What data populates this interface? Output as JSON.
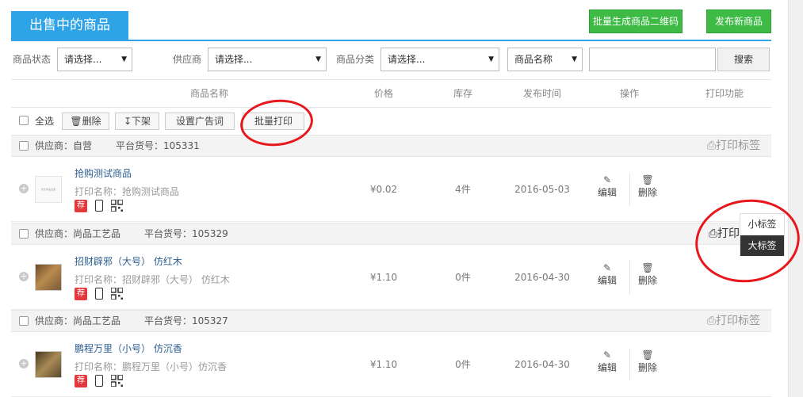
{
  "header": {
    "title": "出售中的商品",
    "qr_button": "批量生成商品二维码",
    "publish_button": "发布新商品"
  },
  "filters": {
    "status_label": "商品状态",
    "status_value": "请选择...",
    "supplier_label": "供应商",
    "supplier_value": "请选择...",
    "category_label": "商品分类",
    "category_value": "请选择...",
    "field_value": "商品名称",
    "keyword_value": "",
    "search_button": "搜索"
  },
  "table_header": {
    "name": "商品名称",
    "price": "价格",
    "stock": "库存",
    "date": "发布时间",
    "ops": "操作",
    "print": "打印功能"
  },
  "batch": {
    "select_all": "全选",
    "delete": "删除",
    "unlist": "下架",
    "ad": "设置广告词",
    "batch_print": "批量打印"
  },
  "groups": [
    {
      "supplier": "供应商：自营",
      "sku": "平台货号：105331",
      "print_label": "打印标签",
      "product": {
        "name": "抢购测试商品",
        "print_name": "打印名称：抢购测试商品",
        "thumb_text": "暂无商品主图",
        "tag": "荐",
        "price": "¥0.02",
        "stock": "4件",
        "date": "2016-05-03",
        "edit": "编辑",
        "delete": "删除"
      }
    },
    {
      "supplier": "供应商：尚品工艺品",
      "sku": "平台货号：105329",
      "print_label": "打印",
      "product": {
        "name": "招财辟邪（大号） 仿红木",
        "print_name": "打印名称：招财辟邪（大号） 仿红木",
        "tag": "荐",
        "price": "¥1.10",
        "stock": "0件",
        "date": "2016-04-30",
        "edit": "编辑",
        "delete": "删除"
      }
    },
    {
      "supplier": "供应商：尚品工艺品",
      "sku": "平台货号：105327",
      "print_label": "打印标签",
      "product": {
        "name": "鹏程万里（小号） 仿沉香",
        "print_name": "打印名称：鹏程万里（小号）仿沉香",
        "tag": "荐",
        "price": "¥1.10",
        "stock": "0件",
        "date": "2016-04-30",
        "edit": "编辑",
        "delete": "删除"
      }
    }
  ],
  "popup": {
    "small_label": "小标签",
    "big_label": "大标签"
  },
  "colors": {
    "accent": "#2ea4e6",
    "green": "#3dbb45",
    "annotation_red": "#e8171b"
  }
}
